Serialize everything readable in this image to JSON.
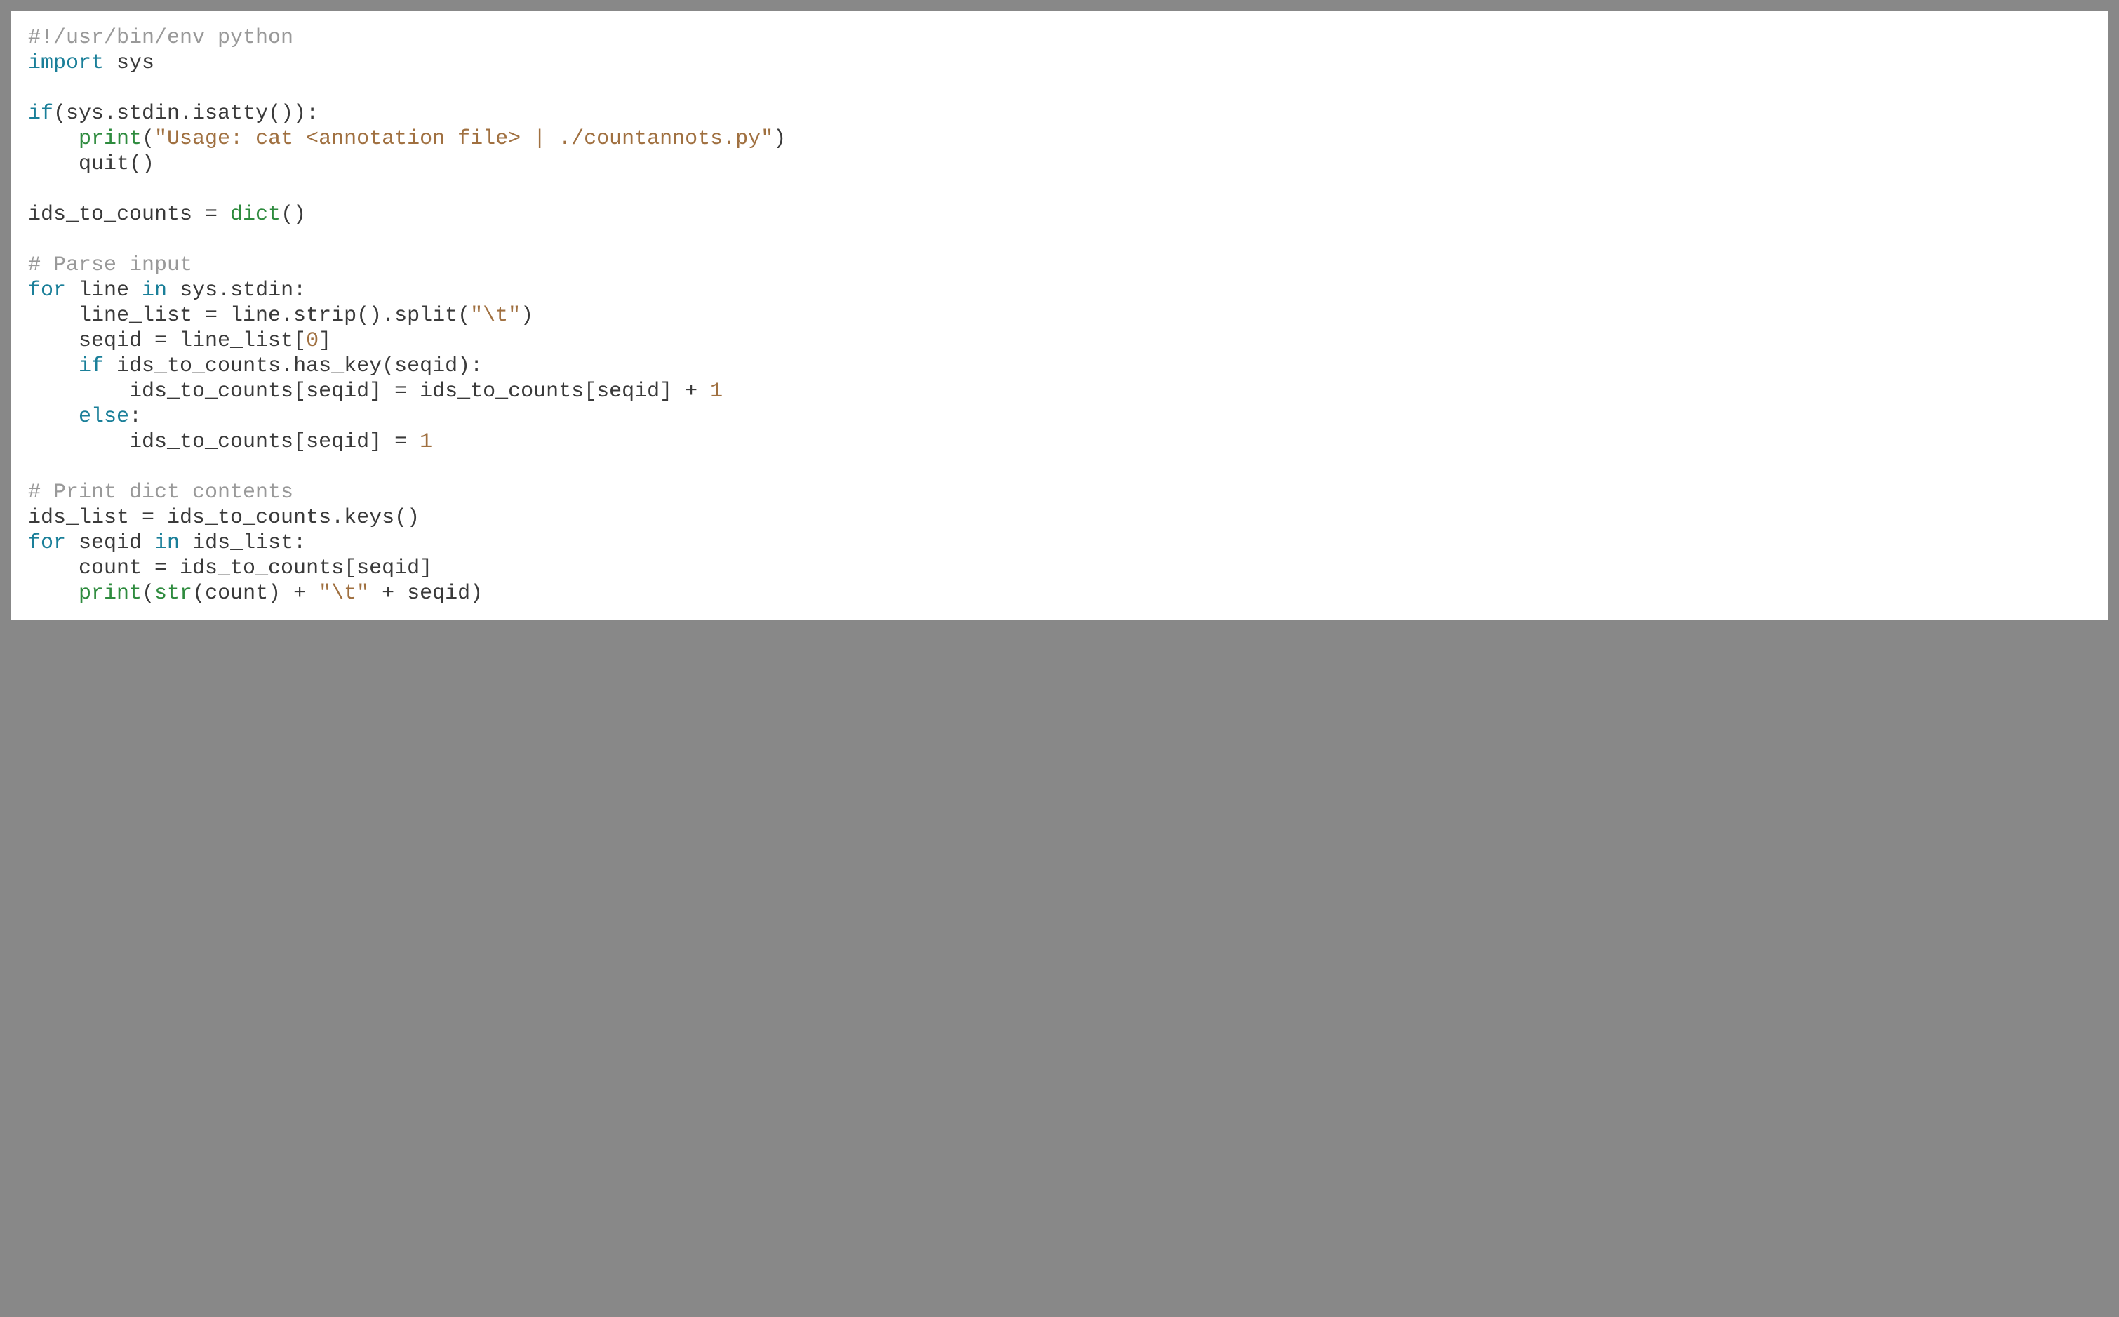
{
  "code": {
    "lines": [
      [
        {
          "t": "#!/usr/bin/env python",
          "c": "c-comment"
        }
      ],
      [
        {
          "t": "import",
          "c": "c-keyword"
        },
        {
          "t": " sys",
          "c": "c-default"
        }
      ],
      [
        {
          "t": "",
          "c": "c-default"
        }
      ],
      [
        {
          "t": "if",
          "c": "c-keyword"
        },
        {
          "t": "(sys.stdin.isatty()):",
          "c": "c-default"
        }
      ],
      [
        {
          "t": "    ",
          "c": "c-default"
        },
        {
          "t": "print",
          "c": "c-builtin"
        },
        {
          "t": "(",
          "c": "c-default"
        },
        {
          "t": "\"Usage: cat <annotation file> | ./countannots.py\"",
          "c": "c-string"
        },
        {
          "t": ")",
          "c": "c-default"
        }
      ],
      [
        {
          "t": "    quit()",
          "c": "c-default"
        }
      ],
      [
        {
          "t": "",
          "c": "c-default"
        }
      ],
      [
        {
          "t": "ids_to_counts = ",
          "c": "c-default"
        },
        {
          "t": "dict",
          "c": "c-builtin"
        },
        {
          "t": "()",
          "c": "c-default"
        }
      ],
      [
        {
          "t": "",
          "c": "c-default"
        }
      ],
      [
        {
          "t": "# Parse input",
          "c": "c-comment"
        }
      ],
      [
        {
          "t": "for",
          "c": "c-keyword"
        },
        {
          "t": " line ",
          "c": "c-default"
        },
        {
          "t": "in",
          "c": "c-keyword"
        },
        {
          "t": " sys.stdin:",
          "c": "c-default"
        }
      ],
      [
        {
          "t": "    line_list = line.strip().split(",
          "c": "c-default"
        },
        {
          "t": "\"\\t\"",
          "c": "c-string"
        },
        {
          "t": ")",
          "c": "c-default"
        }
      ],
      [
        {
          "t": "    seqid = line_list[",
          "c": "c-default"
        },
        {
          "t": "0",
          "c": "c-number"
        },
        {
          "t": "]",
          "c": "c-default"
        }
      ],
      [
        {
          "t": "    ",
          "c": "c-default"
        },
        {
          "t": "if",
          "c": "c-keyword"
        },
        {
          "t": " ids_to_counts.has_key(seqid):",
          "c": "c-default"
        }
      ],
      [
        {
          "t": "        ids_to_counts[seqid] = ids_to_counts[seqid] + ",
          "c": "c-default"
        },
        {
          "t": "1",
          "c": "c-number"
        }
      ],
      [
        {
          "t": "    ",
          "c": "c-default"
        },
        {
          "t": "else",
          "c": "c-keyword"
        },
        {
          "t": ":",
          "c": "c-default"
        }
      ],
      [
        {
          "t": "        ids_to_counts[seqid] = ",
          "c": "c-default"
        },
        {
          "t": "1",
          "c": "c-number"
        }
      ],
      [
        {
          "t": "",
          "c": "c-default"
        }
      ],
      [
        {
          "t": "# Print dict contents",
          "c": "c-comment"
        }
      ],
      [
        {
          "t": "ids_list = ids_to_counts.keys()",
          "c": "c-default"
        }
      ],
      [
        {
          "t": "for",
          "c": "c-keyword"
        },
        {
          "t": " seqid ",
          "c": "c-default"
        },
        {
          "t": "in",
          "c": "c-keyword"
        },
        {
          "t": " ids_list:",
          "c": "c-default"
        }
      ],
      [
        {
          "t": "    count = ids_to_counts[seqid]",
          "c": "c-default"
        }
      ],
      [
        {
          "t": "    ",
          "c": "c-default"
        },
        {
          "t": "print",
          "c": "c-builtin"
        },
        {
          "t": "(",
          "c": "c-default"
        },
        {
          "t": "str",
          "c": "c-builtin"
        },
        {
          "t": "(count) + ",
          "c": "c-default"
        },
        {
          "t": "\"\\t\"",
          "c": "c-string"
        },
        {
          "t": " + seqid)",
          "c": "c-default"
        }
      ]
    ]
  }
}
